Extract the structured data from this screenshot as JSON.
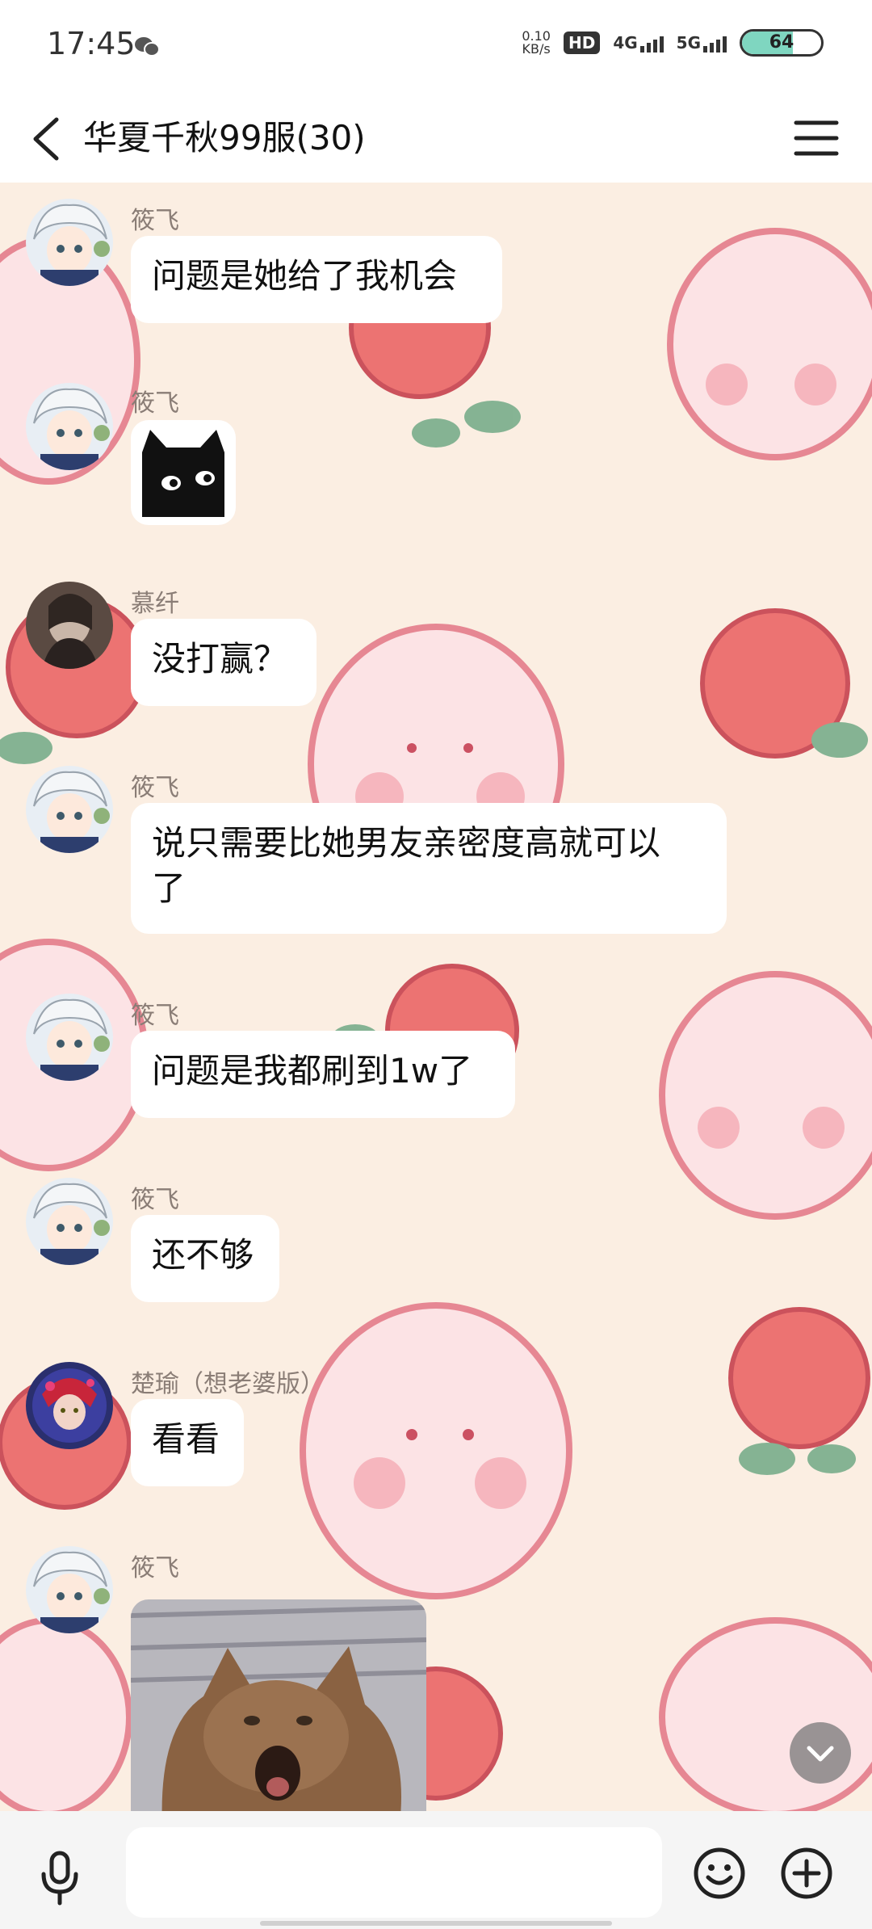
{
  "status_bar": {
    "time": "17:45",
    "speed_value": "0.10",
    "speed_unit": "KB/s",
    "hd_badge": "HD",
    "network_1": "4G",
    "network_2": "5G",
    "battery": "64",
    "battery_level_percent": 64
  },
  "header": {
    "title": "华夏千秋99服(30)"
  },
  "messages": [
    {
      "sender": "筱飞",
      "text": "问题是她给了我机会"
    },
    {
      "sender": "筱飞",
      "image": "black-cat-sticker"
    },
    {
      "sender": "慕纤",
      "text": "没打赢？"
    },
    {
      "sender": "筱飞",
      "text_line1": "说只需要比她男友亲密度高就可以",
      "text_line2": "了"
    },
    {
      "sender": "筱飞",
      "text": "问题是我都刷到1w了"
    },
    {
      "sender": "筱飞",
      "text": "还不够"
    },
    {
      "sender": "楚瑜（想老婆版）",
      "text": "看看"
    },
    {
      "sender": "筱飞",
      "image": "screaming-cat-photo"
    }
  ],
  "input": {
    "placeholder": "",
    "value": ""
  },
  "colors": {
    "chat_background": "#fbeee2",
    "bubble": "#ffffff",
    "accent_teal": "#7fd6c0"
  }
}
